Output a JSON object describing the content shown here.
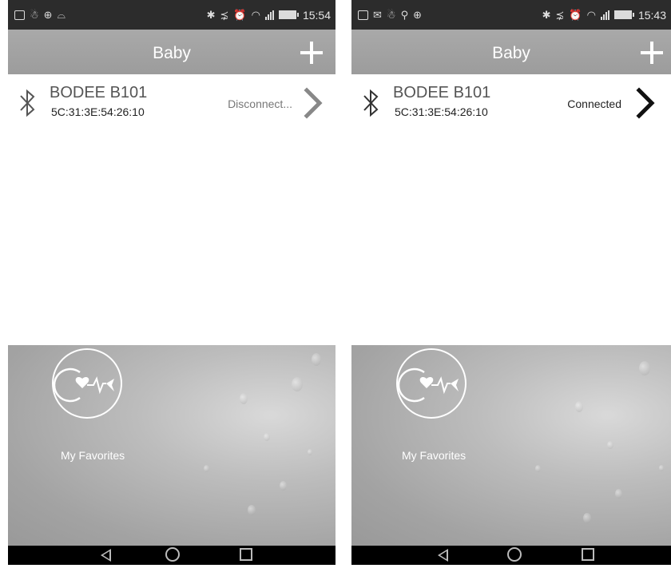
{
  "screens": [
    {
      "statusbar": {
        "time": "15:54"
      },
      "appbar": {
        "title": "Baby"
      },
      "device": {
        "name": "BODEE B101",
        "mac": "5C:31:3E:54:26:10",
        "status": "Disconnect..."
      },
      "favorites": {
        "label": "My Favorites"
      }
    },
    {
      "statusbar": {
        "time": "15:43"
      },
      "appbar": {
        "title": "Baby"
      },
      "device": {
        "name": "BODEE B101",
        "mac": "5C:31:3E:54:26:10",
        "status": "Connected"
      },
      "favorites": {
        "label": "My Favorites"
      }
    }
  ],
  "icons": {
    "appbar": "plus-icon",
    "device": "bluetooth-icon",
    "row_action": "chevron-right-icon",
    "favorites": "heart-pulse-logo-icon",
    "nav": [
      "back-icon",
      "home-icon",
      "recent-apps-icon"
    ]
  },
  "colors": {
    "status_bar": "#2c2c2c",
    "app_bar": "#a3a3a3",
    "status_disconnected": "#777777",
    "status_connected": "#222222"
  }
}
